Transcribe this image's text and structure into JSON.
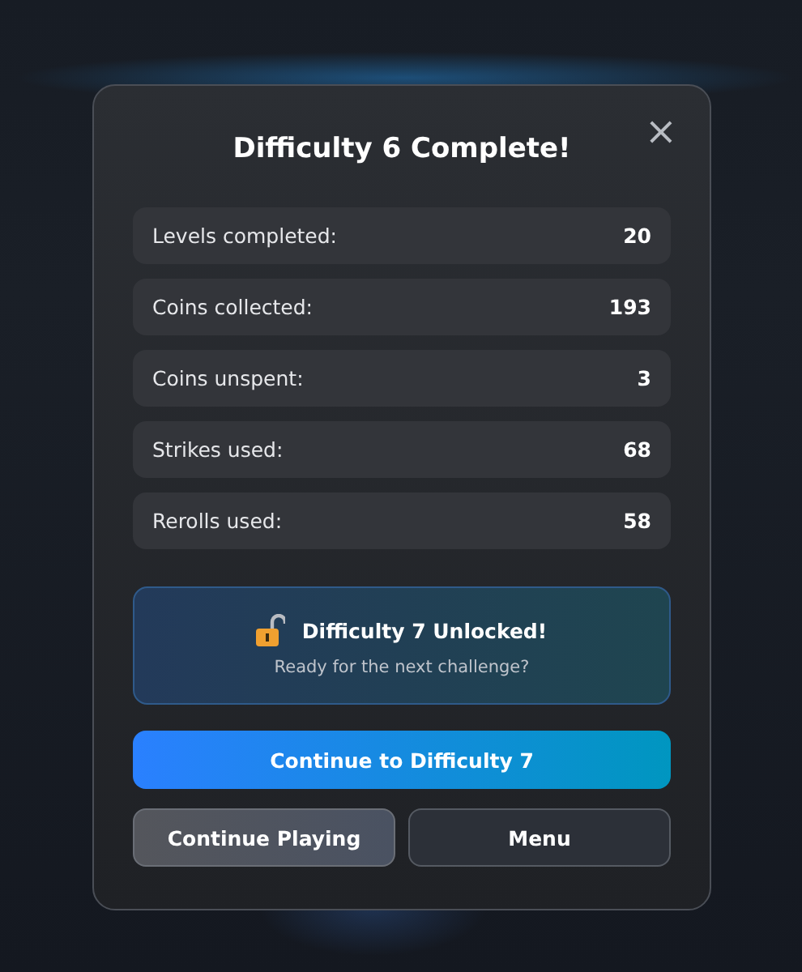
{
  "dialog": {
    "title": "Difficulty 6 Complete!",
    "close": "×",
    "stats": [
      {
        "label": "Levels completed:",
        "value": "20"
      },
      {
        "label": "Coins collected:",
        "value": "193"
      },
      {
        "label": "Coins unspent:",
        "value": "3"
      },
      {
        "label": "Strikes used:",
        "value": "68"
      },
      {
        "label": "Rerolls used:",
        "value": "58"
      }
    ],
    "unlock": {
      "title": "Difficulty 7 Unlocked!",
      "subtitle": "Ready for the next challenge?"
    },
    "primary_button": "Continue to Difficulty 7",
    "buttons": [
      {
        "label": "Continue Playing",
        "focused": true
      },
      {
        "label": "Menu",
        "focused": false
      }
    ]
  }
}
